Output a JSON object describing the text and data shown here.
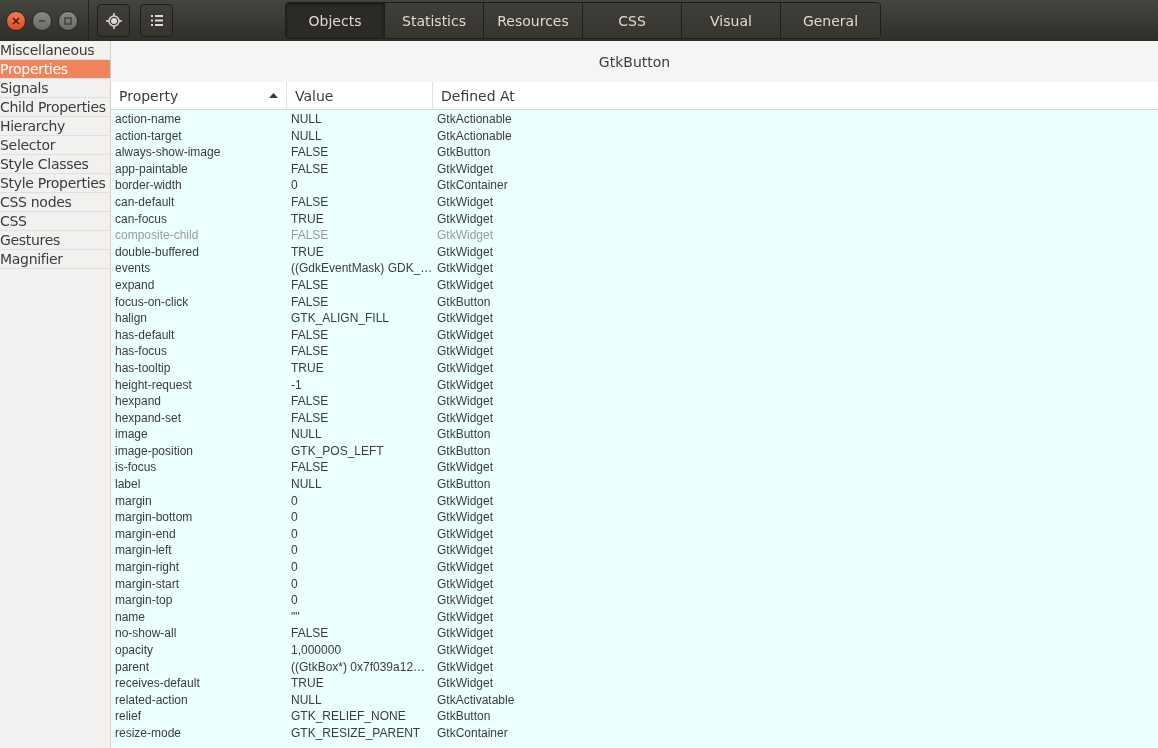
{
  "toolbar": {
    "tabs": [
      {
        "label": "Objects",
        "selected": true
      },
      {
        "label": "Statistics",
        "selected": false
      },
      {
        "label": "Resources",
        "selected": false
      },
      {
        "label": "CSS",
        "selected": false
      },
      {
        "label": "Visual",
        "selected": false
      },
      {
        "label": "General",
        "selected": false
      }
    ]
  },
  "sidebar": {
    "items": [
      {
        "label": "Miscellaneous",
        "selected": false
      },
      {
        "label": "Properties",
        "selected": true
      },
      {
        "label": "Signals",
        "selected": false
      },
      {
        "label": "Child Properties",
        "selected": false
      },
      {
        "label": "Hierarchy",
        "selected": false
      },
      {
        "label": "Selector",
        "selected": false
      },
      {
        "label": "Style Classes",
        "selected": false
      },
      {
        "label": "Style Properties",
        "selected": false
      },
      {
        "label": "CSS nodes",
        "selected": false
      },
      {
        "label": "CSS",
        "selected": false
      },
      {
        "label": "Gestures",
        "selected": false
      },
      {
        "label": "Magnifier",
        "selected": false
      }
    ]
  },
  "object_title": "GtkButton",
  "table": {
    "columns": [
      {
        "label": "Property",
        "sorted": true
      },
      {
        "label": "Value",
        "sorted": false
      },
      {
        "label": "Defined At",
        "sorted": false
      }
    ],
    "rows": [
      {
        "property": "action-name",
        "value": "NULL",
        "defined_at": "GtkActionable",
        "disabled": false
      },
      {
        "property": "action-target",
        "value": "NULL",
        "defined_at": "GtkActionable",
        "disabled": false
      },
      {
        "property": "always-show-image",
        "value": "FALSE",
        "defined_at": "GtkButton",
        "disabled": false
      },
      {
        "property": "app-paintable",
        "value": "FALSE",
        "defined_at": "GtkWidget",
        "disabled": false
      },
      {
        "property": "border-width",
        "value": "0",
        "defined_at": "GtkContainer",
        "disabled": false
      },
      {
        "property": "can-default",
        "value": "FALSE",
        "defined_at": "GtkWidget",
        "disabled": false
      },
      {
        "property": "can-focus",
        "value": "TRUE",
        "defined_at": "GtkWidget",
        "disabled": false
      },
      {
        "property": "composite-child",
        "value": "FALSE",
        "defined_at": "GtkWidget",
        "disabled": true
      },
      {
        "property": "double-buffered",
        "value": "TRUE",
        "defined_at": "GtkWidget",
        "disabled": false
      },
      {
        "property": "events",
        "value": "((GdkEventMask) GDK_…",
        "defined_at": "GtkWidget",
        "disabled": false
      },
      {
        "property": "expand",
        "value": "FALSE",
        "defined_at": "GtkWidget",
        "disabled": false
      },
      {
        "property": "focus-on-click",
        "value": "FALSE",
        "defined_at": "GtkButton",
        "disabled": false
      },
      {
        "property": "halign",
        "value": "GTK_ALIGN_FILL",
        "defined_at": "GtkWidget",
        "disabled": false
      },
      {
        "property": "has-default",
        "value": "FALSE",
        "defined_at": "GtkWidget",
        "disabled": false
      },
      {
        "property": "has-focus",
        "value": "FALSE",
        "defined_at": "GtkWidget",
        "disabled": false
      },
      {
        "property": "has-tooltip",
        "value": "TRUE",
        "defined_at": "GtkWidget",
        "disabled": false
      },
      {
        "property": "height-request",
        "value": "-1",
        "defined_at": "GtkWidget",
        "disabled": false
      },
      {
        "property": "hexpand",
        "value": "FALSE",
        "defined_at": "GtkWidget",
        "disabled": false
      },
      {
        "property": "hexpand-set",
        "value": "FALSE",
        "defined_at": "GtkWidget",
        "disabled": false
      },
      {
        "property": "image",
        "value": "NULL",
        "defined_at": "GtkButton",
        "disabled": false
      },
      {
        "property": "image-position",
        "value": "GTK_POS_LEFT",
        "defined_at": "GtkButton",
        "disabled": false
      },
      {
        "property": "is-focus",
        "value": "FALSE",
        "defined_at": "GtkWidget",
        "disabled": false
      },
      {
        "property": "label",
        "value": "NULL",
        "defined_at": "GtkButton",
        "disabled": false
      },
      {
        "property": "margin",
        "value": "0",
        "defined_at": "GtkWidget",
        "disabled": false
      },
      {
        "property": "margin-bottom",
        "value": "0",
        "defined_at": "GtkWidget",
        "disabled": false
      },
      {
        "property": "margin-end",
        "value": "0",
        "defined_at": "GtkWidget",
        "disabled": false
      },
      {
        "property": "margin-left",
        "value": "0",
        "defined_at": "GtkWidget",
        "disabled": false
      },
      {
        "property": "margin-right",
        "value": "0",
        "defined_at": "GtkWidget",
        "disabled": false
      },
      {
        "property": "margin-start",
        "value": "0",
        "defined_at": "GtkWidget",
        "disabled": false
      },
      {
        "property": "margin-top",
        "value": "0",
        "defined_at": "GtkWidget",
        "disabled": false
      },
      {
        "property": "name",
        "value": "\"\"",
        "defined_at": "GtkWidget",
        "disabled": false
      },
      {
        "property": "no-show-all",
        "value": "FALSE",
        "defined_at": "GtkWidget",
        "disabled": false
      },
      {
        "property": "opacity",
        "value": "1,000000",
        "defined_at": "GtkWidget",
        "disabled": false
      },
      {
        "property": "parent",
        "value": "((GtkBox*) 0x7f039a12…",
        "defined_at": "GtkWidget",
        "disabled": false
      },
      {
        "property": "receives-default",
        "value": "TRUE",
        "defined_at": "GtkWidget",
        "disabled": false
      },
      {
        "property": "related-action",
        "value": "NULL",
        "defined_at": "GtkActivatable",
        "disabled": false
      },
      {
        "property": "relief",
        "value": "GTK_RELIEF_NONE",
        "defined_at": "GtkButton",
        "disabled": false
      },
      {
        "property": "resize-mode",
        "value": "GTK_RESIZE_PARENT",
        "defined_at": "GtkContainer",
        "disabled": false
      }
    ]
  }
}
